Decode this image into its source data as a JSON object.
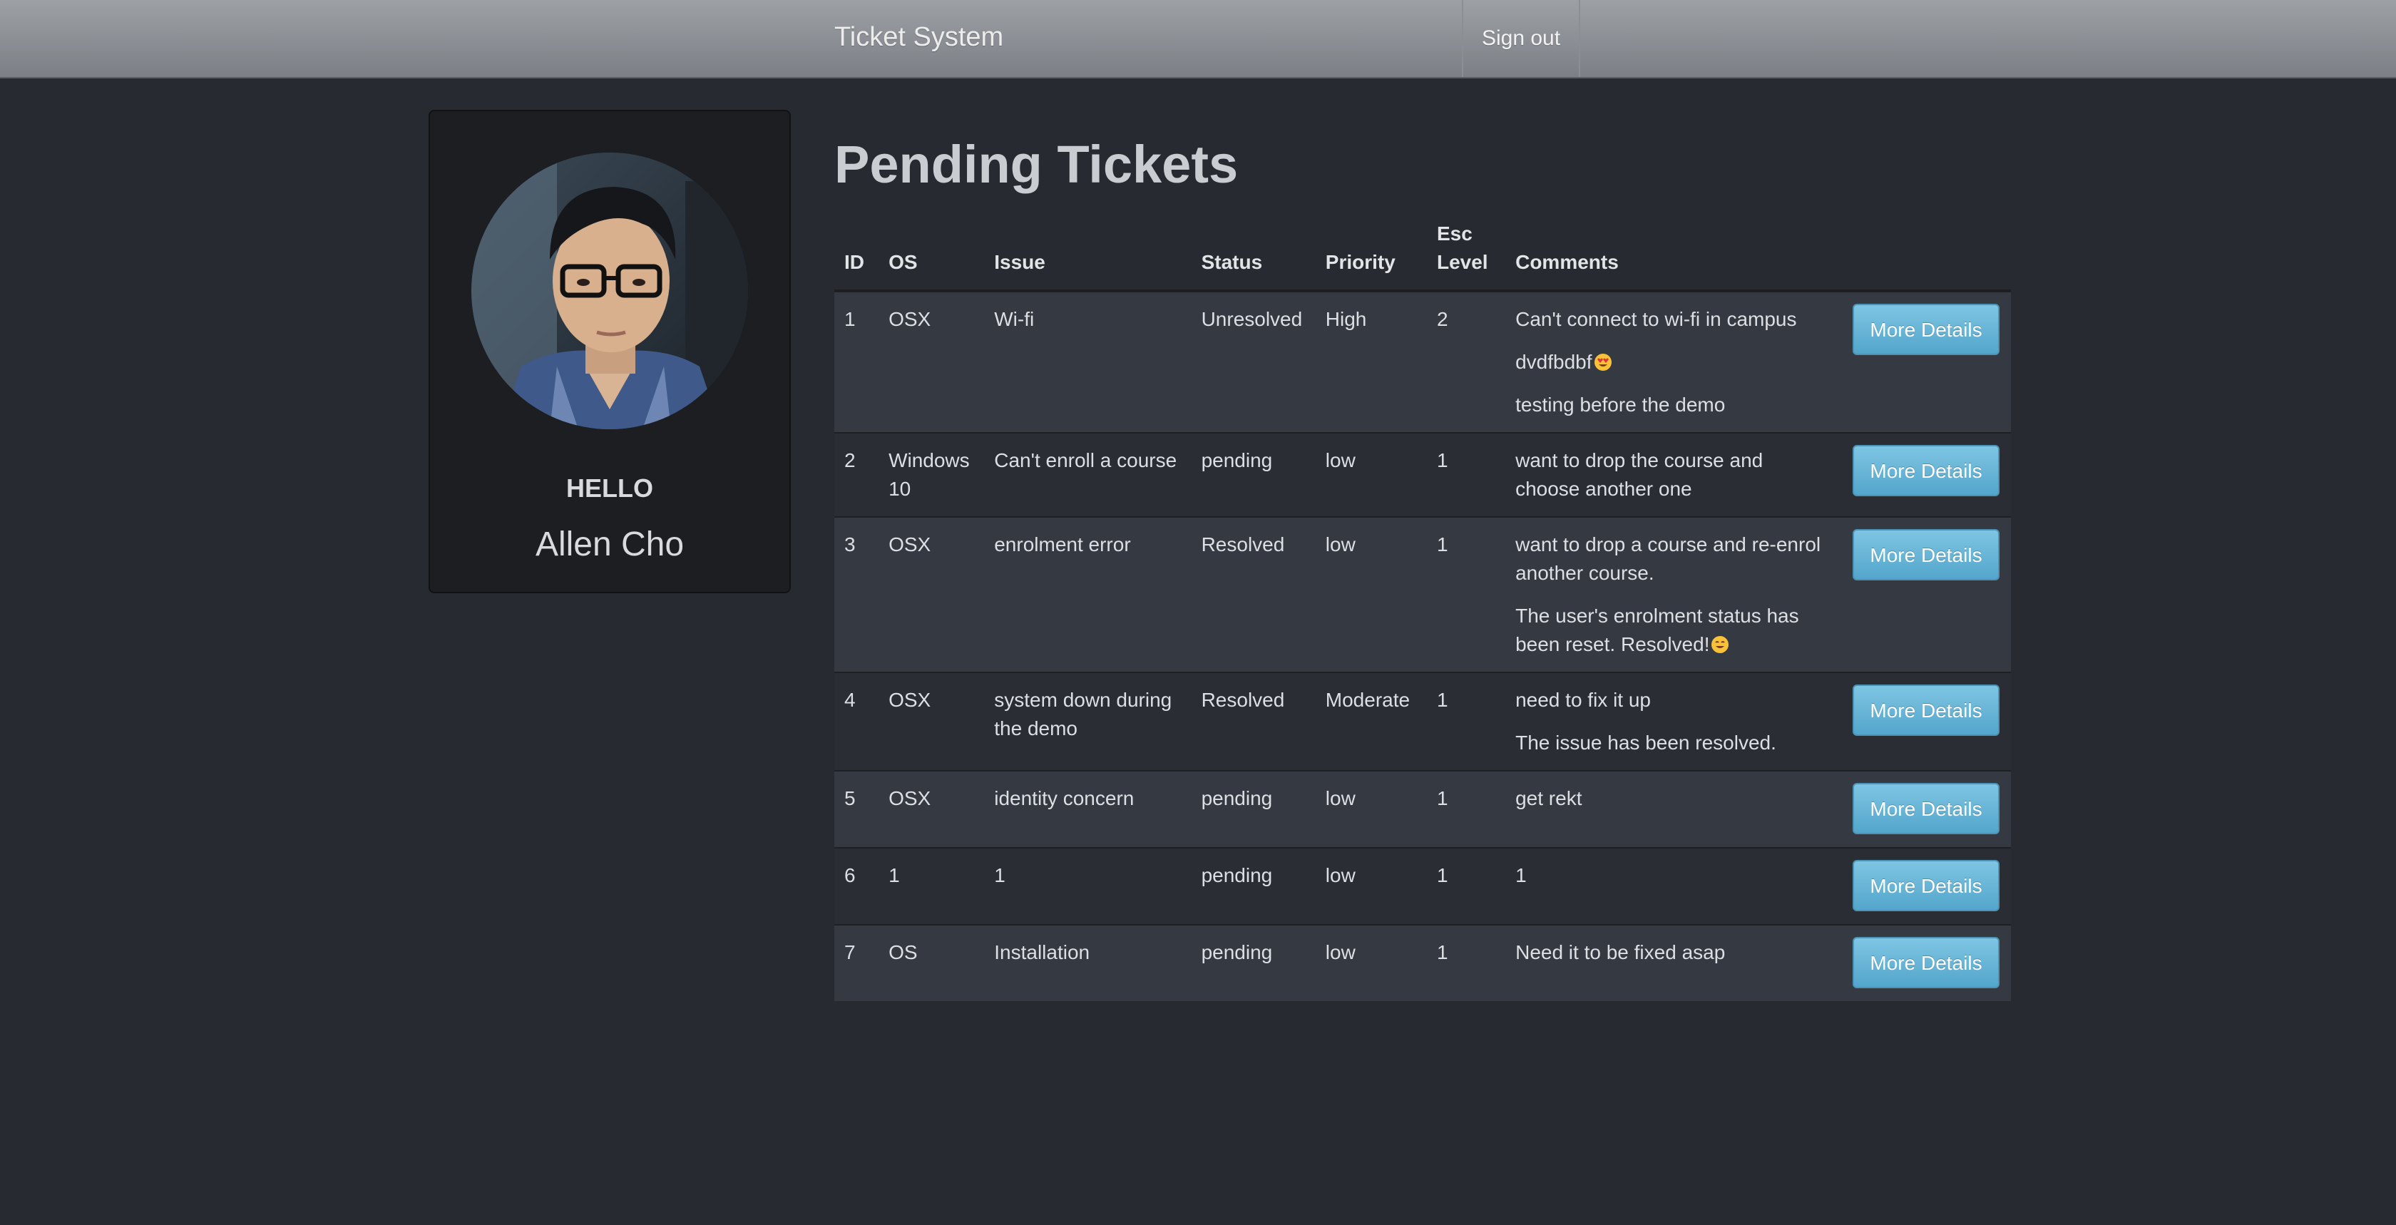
{
  "navbar": {
    "brand": "Ticket System",
    "sign_out": "Sign out"
  },
  "profile": {
    "greeting": "HELLO",
    "name": "Allen Cho",
    "avatar_icon": "user-avatar-photo"
  },
  "main": {
    "title": "Pending Tickets",
    "columns": {
      "id": "ID",
      "os": "OS",
      "issue": "Issue",
      "status": "Status",
      "priority": "Priority",
      "esc_level": "Esc Level",
      "comments": "Comments"
    },
    "tickets": [
      {
        "id": "1",
        "os": "OSX",
        "issue": "Wi-fi",
        "status": "Unresolved",
        "priority": "High",
        "esc_level": "2",
        "comments": [
          "Can't connect to wi-fi in campus",
          "dvdfbdbf",
          "testing before the demo"
        ],
        "action": "More Details"
      },
      {
        "id": "2",
        "os": "Windows 10",
        "issue": "Can't enroll a course",
        "status": "pending",
        "priority": "low",
        "esc_level": "1",
        "comments": [
          "want to drop the course and choose another one"
        ],
        "action": "More Details"
      },
      {
        "id": "3",
        "os": "OSX",
        "issue": "enrolment error",
        "status": "Resolved",
        "priority": "low",
        "esc_level": "1",
        "comments": [
          "want to drop a course and re-enrol another course.",
          "The user's enrolment status has been reset. Resolved!"
        ],
        "action": "More Details"
      },
      {
        "id": "4",
        "os": "OSX",
        "issue": "system down during the demo",
        "status": "Resolved",
        "priority": "Moderate",
        "esc_level": "1",
        "comments": [
          "need to fix it up",
          "The issue has been resolved."
        ],
        "action": "More Details"
      },
      {
        "id": "5",
        "os": "OSX",
        "issue": "identity concern",
        "status": "pending",
        "priority": "low",
        "esc_level": "1",
        "comments": [
          "get rekt"
        ],
        "action": "More Details"
      },
      {
        "id": "6",
        "os": "1",
        "issue": "1",
        "status": "pending",
        "priority": "low",
        "esc_level": "1",
        "comments": [
          "1"
        ],
        "action": "More Details"
      },
      {
        "id": "7",
        "os": "OS",
        "issue": "Installation",
        "status": "pending",
        "priority": "low",
        "esc_level": "1",
        "comments": [
          "Need it to be fixed asap"
        ],
        "action": "More Details"
      }
    ],
    "emoji": {
      "heart_eyes": "heart-eyes-emoji-icon",
      "smile": "smiling-emoji-icon"
    }
  },
  "colors": {
    "background": "#272a30",
    "navbar": "#8a8e93",
    "button": "#5eb0d5",
    "row_odd": "#353941",
    "row_even": "#2a2d33"
  }
}
